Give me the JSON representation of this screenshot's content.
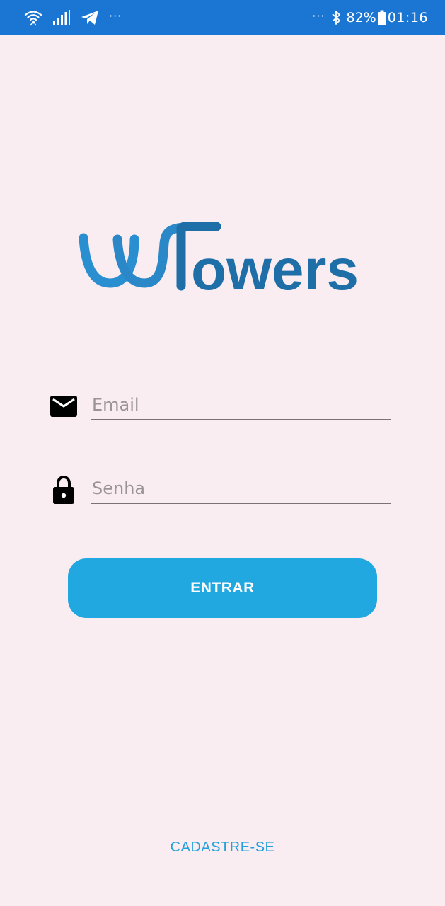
{
  "status_bar": {
    "left_overflow": "···",
    "right_overflow": "···",
    "battery_percent": "82%",
    "time": "01:16",
    "icons": [
      "wifi-icon",
      "signal-icon",
      "telegram-icon",
      "bluetooth-icon",
      "battery-icon"
    ]
  },
  "logo": {
    "text": "owers",
    "colors": {
      "light_blue": "#2a8fd0",
      "dark_blue": "#1e6fa8"
    }
  },
  "form": {
    "email": {
      "placeholder": "Email",
      "value": "",
      "icon": "mail-icon"
    },
    "password": {
      "placeholder": "Senha",
      "value": "",
      "icon": "lock-icon"
    }
  },
  "actions": {
    "login_label": "ENTRAR",
    "signup_label": "CADASTRE-SE"
  },
  "colors": {
    "status_bar": "#1a76d2",
    "background": "#f9edf1",
    "button": "#21a8e1",
    "link": "#21a0db"
  }
}
